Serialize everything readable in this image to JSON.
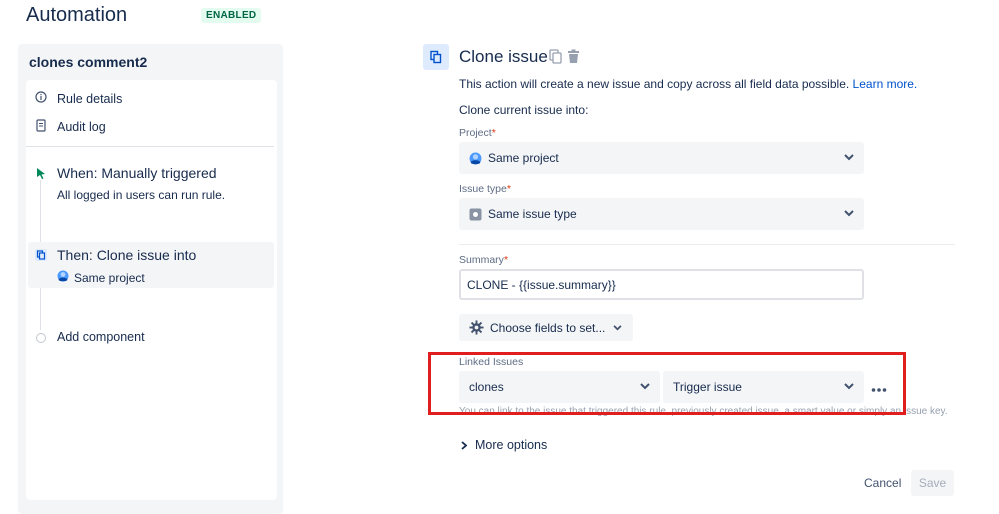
{
  "page": {
    "title": "Automation",
    "status_badge": "ENABLED"
  },
  "sidebar": {
    "rule_name": "clones comment2",
    "items": [
      {
        "label": "Rule details",
        "icon": "info-icon"
      },
      {
        "label": "Audit log",
        "icon": "document-icon"
      }
    ],
    "steps": [
      {
        "title": "When: Manually triggered",
        "subtitle": "All logged in users can run rule.",
        "icon": "cursor-click-icon"
      },
      {
        "title": "Then: Clone issue into",
        "subtitle": "Same project",
        "icon": "clone-icon"
      }
    ],
    "add_component": "Add component"
  },
  "main": {
    "title": "Clone issue",
    "description": "This action will create a new issue and copy across all field data possible.",
    "learn_more": "Learn more.",
    "clone_into_label": "Clone current issue into:",
    "project": {
      "label": "Project",
      "value": "Same project"
    },
    "issue_type": {
      "label": "Issue type",
      "value": "Same issue type"
    },
    "summary": {
      "label": "Summary",
      "value": "CLONE - {{issue.summary}}"
    },
    "choose_fields": "Choose fields to set...",
    "linked_issues": {
      "label": "Linked Issues",
      "link_type": "clones",
      "target": "Trigger issue",
      "hint": "You can link to the issue that triggered this rule, previously created issue, a smart value or simply an issue key."
    },
    "more_options": "More options",
    "cancel": "Cancel",
    "save": "Save"
  },
  "colors": {
    "accent": "#0052cc",
    "highlight": "#e01e1e",
    "badge_bg": "#e3fcef",
    "badge_text": "#006644"
  }
}
